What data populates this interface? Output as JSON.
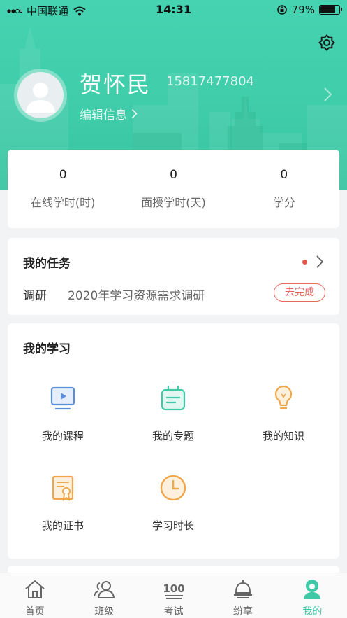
{
  "status_bar": {
    "carrier": "中国联通",
    "time": "14:31",
    "battery": "79%",
    "battery_level": 0.79
  },
  "profile": {
    "name": "贺怀民",
    "phone": "15817477804",
    "edit_label": "编辑信息"
  },
  "stats": [
    {
      "value": "0",
      "label": "在线学时(时)"
    },
    {
      "value": "0",
      "label": "面授学时(天)"
    },
    {
      "value": "0",
      "label": "学分"
    }
  ],
  "tasks": {
    "title": "我的任务",
    "item": {
      "type": "调研",
      "name": "2020年学习资源需求调研",
      "action": "去完成"
    }
  },
  "learning": {
    "title": "我的学习",
    "items": [
      {
        "label": "我的课程",
        "icon": "video-play-icon",
        "color": "#5b8fd9"
      },
      {
        "label": "我的专题",
        "icon": "topic-tv-icon",
        "color": "#3fc9a7"
      },
      {
        "label": "我的知识",
        "icon": "lightbulb-icon",
        "color": "#f0a64a"
      },
      {
        "label": "我的证书",
        "icon": "certificate-icon",
        "color": "#f0a64a"
      },
      {
        "label": "学习时长",
        "icon": "clock-icon",
        "color": "#f0a64a"
      }
    ]
  },
  "tabbar": {
    "active": "我的",
    "items": [
      {
        "label": "首页",
        "icon": "home-icon"
      },
      {
        "label": "班级",
        "icon": "class-icon"
      },
      {
        "label": "考试",
        "icon": "exam-100-icon"
      },
      {
        "label": "纷享",
        "icon": "share-icon"
      },
      {
        "label": "我的",
        "icon": "profile-icon"
      }
    ]
  },
  "colors": {
    "brand": "#3fc9a7",
    "task_action": "#e46a62",
    "dot": "#e6584f"
  }
}
